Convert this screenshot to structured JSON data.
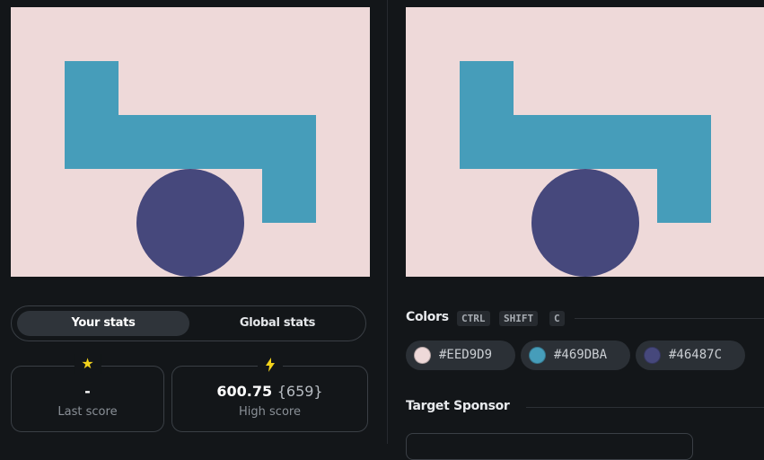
{
  "canvases": {
    "yours": {
      "background": "#EED9D9",
      "shape_color": "#469DBA",
      "circle_color": "#46487C"
    },
    "target": {
      "background": "#EED9D9",
      "shape_color": "#469DBA",
      "circle_color": "#46487C"
    }
  },
  "stats_tabs": [
    {
      "label": "Your stats",
      "active": true
    },
    {
      "label": "Global stats",
      "active": false
    }
  ],
  "stats": {
    "last_score": {
      "value": "-",
      "label": "Last score",
      "icon": "star-icon"
    },
    "high_score": {
      "value": "600.75",
      "sub": "{659}",
      "label": "High score",
      "icon": "lightning-icon"
    }
  },
  "colors_section": {
    "title": "Colors",
    "shortcut": [
      "CTRL",
      "SHIFT",
      "C"
    ],
    "swatches": [
      {
        "hex": "#EED9D9",
        "color": "#EED9D9"
      },
      {
        "hex": "#469DBA",
        "color": "#469DBA"
      },
      {
        "hex": "#46487C",
        "color": "#46487C"
      }
    ]
  },
  "sponsor_section": {
    "title": "Target Sponsor"
  }
}
